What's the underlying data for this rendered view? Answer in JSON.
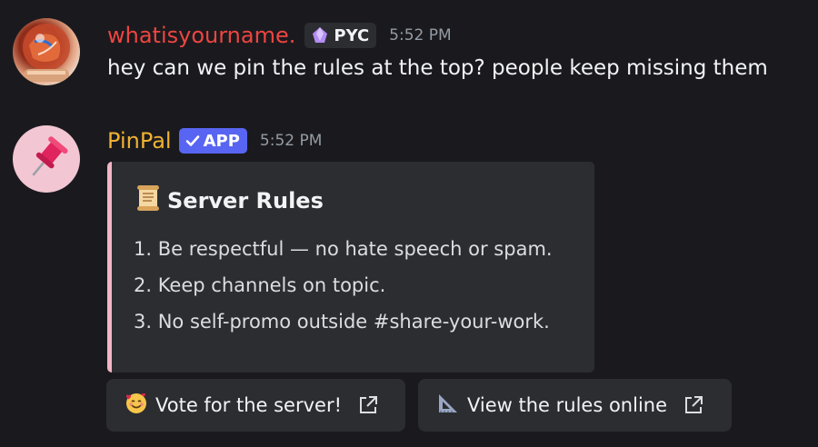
{
  "messages": [
    {
      "username": "whatisyourname.",
      "username_color": "#ee4540",
      "tag": "PYC",
      "timestamp": "5:52 PM",
      "text": "hey can we pin the rules at the top? people keep missing them"
    },
    {
      "username": "PinPal",
      "username_color": "#f0b232",
      "tag": "APP",
      "timestamp": "5:52 PM"
    }
  ],
  "embed": {
    "accent_color": "#f1b6c6",
    "title_icon": "scroll-icon",
    "title": "Server Rules",
    "rules": [
      "1. Be respectful — no hate speech or spam.",
      "2. Keep channels on topic.",
      "3. No self-promo outside #share-your-work."
    ]
  },
  "buttons": [
    {
      "label": "Vote for the server!",
      "icon": "smiling-face-with-hearts-icon"
    },
    {
      "label": "View the rules online",
      "icon": "triangular-ruler-icon"
    }
  ]
}
